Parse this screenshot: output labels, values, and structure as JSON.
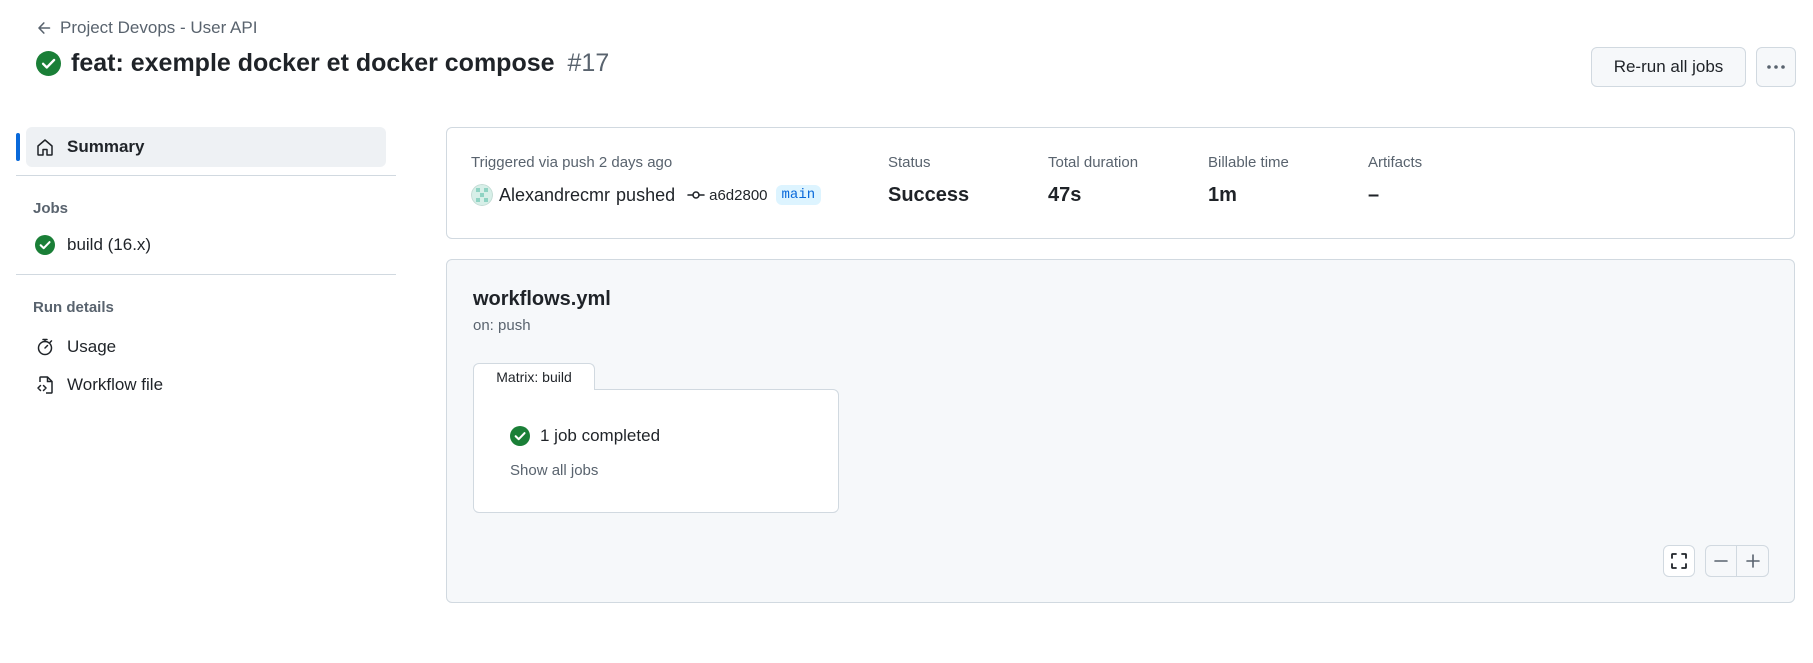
{
  "header": {
    "back_label": "Project Devops - User API",
    "title": "feat: exemple docker et docker compose",
    "run_number": "#17",
    "rerun_label": "Re-run all jobs",
    "more_label": "···"
  },
  "sidebar": {
    "summary_label": "Summary",
    "jobs_title": "Jobs",
    "jobs": [
      {
        "label": "build (16.x)",
        "status": "success"
      }
    ],
    "run_details_title": "Run details",
    "run_details": [
      {
        "label": "Usage",
        "icon": "stopwatch-icon"
      },
      {
        "label": "Workflow file",
        "icon": "file-code-icon"
      }
    ]
  },
  "summary": {
    "trigger_label": "Triggered via push 2 days ago",
    "actor": "Alexandrecmr",
    "action": "pushed",
    "commit": "a6d2800",
    "branch": "main",
    "status_label": "Status",
    "status_value": "Success",
    "duration_label": "Total duration",
    "duration_value": "47s",
    "billable_label": "Billable time",
    "billable_value": "1m",
    "artifacts_label": "Artifacts",
    "artifacts_value": "–"
  },
  "workflow": {
    "name": "workflows.yml",
    "trigger": "on: push",
    "matrix_tab": "Matrix: build",
    "job_summary": "1 job completed",
    "show_all": "Show all jobs"
  },
  "colors": {
    "success": "#1a7f37",
    "accent": "#0969da",
    "branch_bg": "#ddf4ff"
  }
}
